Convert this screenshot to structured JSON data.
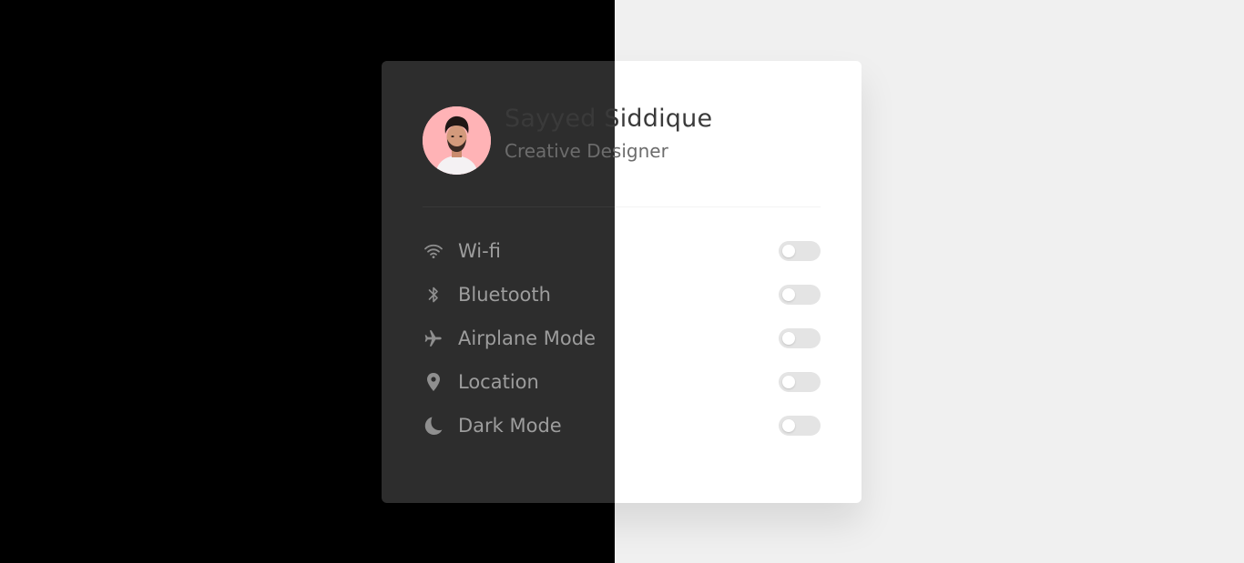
{
  "colors": {
    "left_background": "#000000",
    "right_background": "#f0f0f0",
    "card_dark_half": "#2d2d2d",
    "card_light_half": "#ffffff",
    "avatar_background": "#ffb3b6",
    "toggle_track": "#e4e4e4",
    "label_text": "#9d9d9d"
  },
  "profile": {
    "name": "Sayyed Siddique",
    "role": "Creative Designer",
    "avatar_icon": "user-photo"
  },
  "settings": [
    {
      "label": "Wi-fi",
      "icon": "wifi-icon",
      "enabled": false
    },
    {
      "label": "Bluetooth",
      "icon": "bluetooth-icon",
      "enabled": false
    },
    {
      "label": "Airplane Mode",
      "icon": "airplane-icon",
      "enabled": false
    },
    {
      "label": "Location",
      "icon": "location-pin-icon",
      "enabled": false
    },
    {
      "label": "Dark Mode",
      "icon": "moon-icon",
      "enabled": false
    }
  ]
}
